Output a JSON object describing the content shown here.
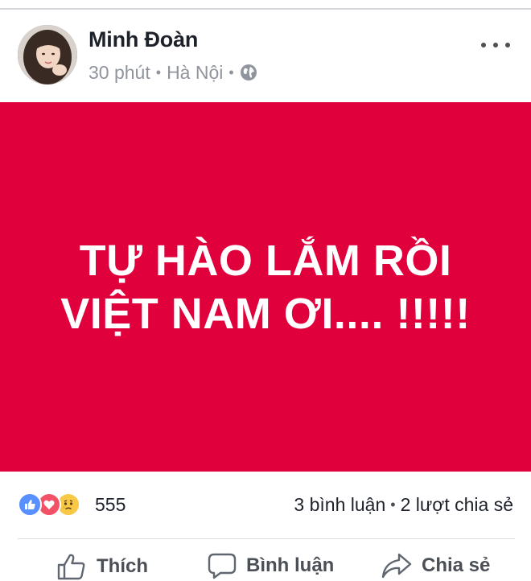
{
  "post": {
    "author": "Minh Đoàn",
    "time": "30 phút",
    "location": "Hà Nội",
    "privacy_icon": "globe-icon"
  },
  "image": {
    "line1": "TỰ HÀO LẮM RỒI",
    "line2": "VIỆT NAM ƠI.... !!!!!",
    "background": "#e0003c"
  },
  "reactions": {
    "icons": [
      "like-reaction-icon",
      "love-reaction-icon",
      "sad-reaction-icon"
    ],
    "count": "555",
    "comments": "3 bình luận",
    "shares": "2 lượt chia sẻ"
  },
  "actions": {
    "like": "Thích",
    "comment": "Bình luận",
    "share": "Chia sẻ"
  }
}
